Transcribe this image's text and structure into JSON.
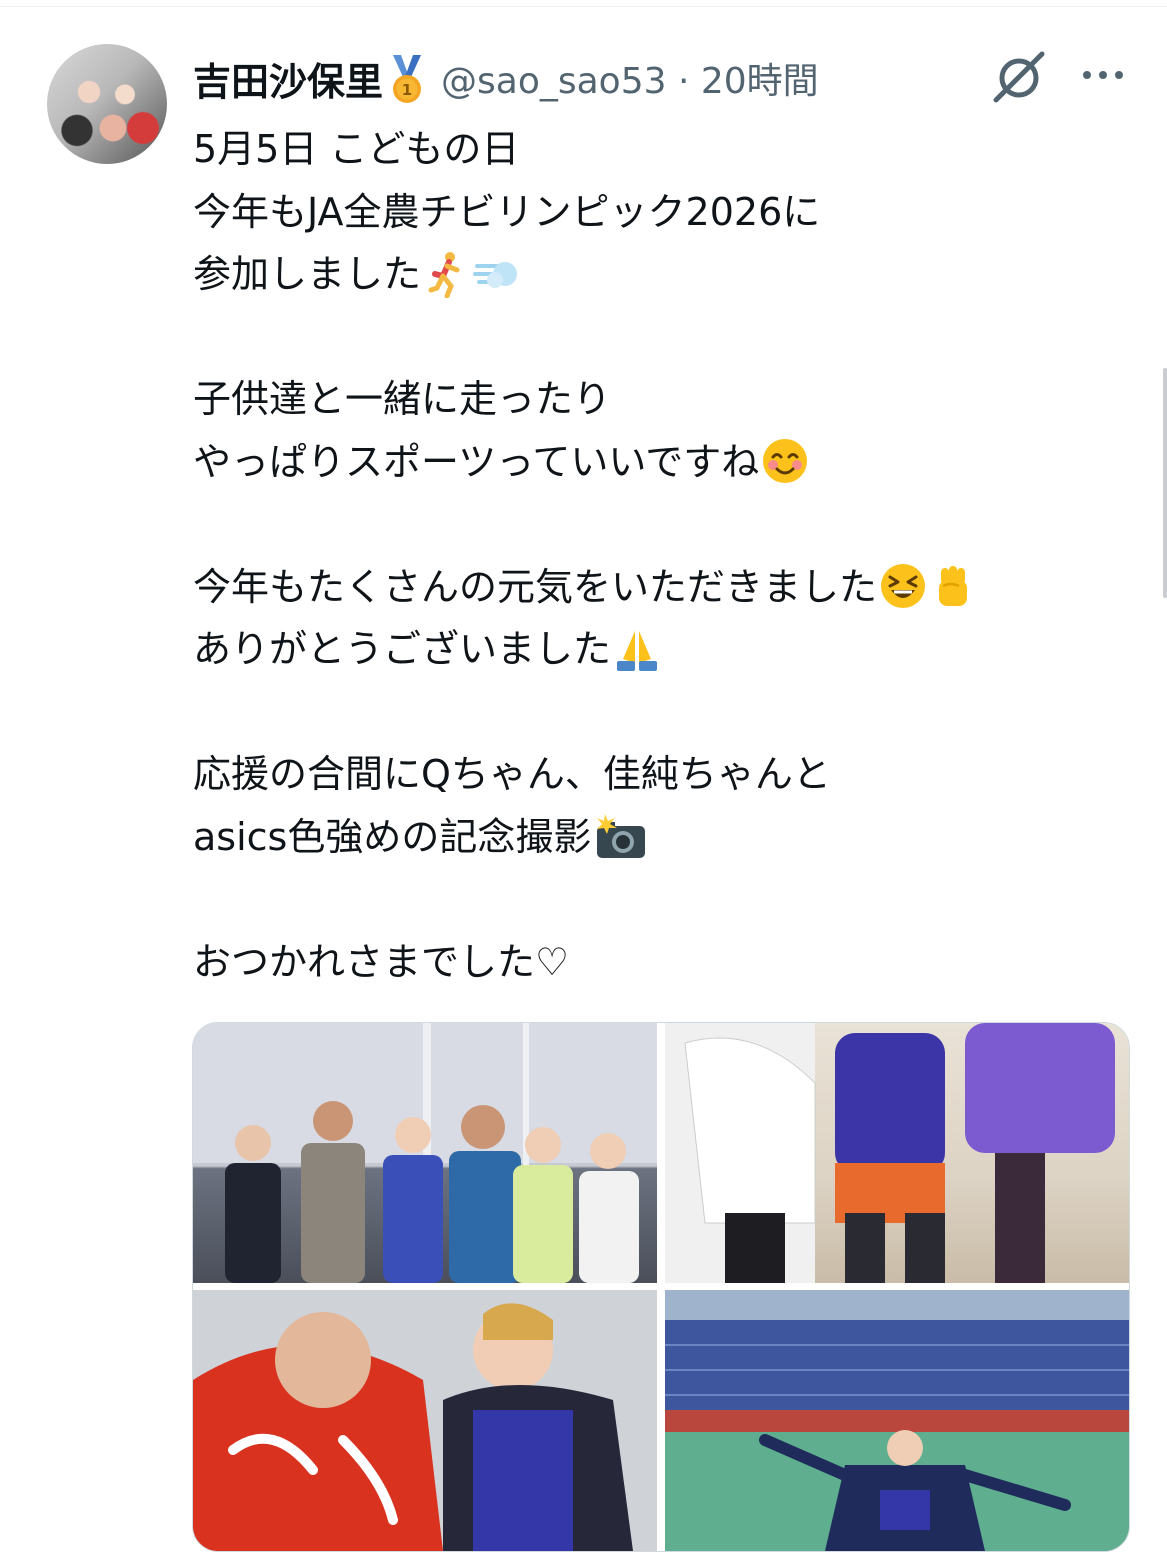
{
  "tweet": {
    "author_name": "吉田沙保里",
    "author_badge": "medal-icon",
    "handle_time": "@sao_sao53 · 20時間",
    "lines": [
      "5月5日 こどもの日",
      "今年もJA全農チビリンピック2026に",
      "参加しました",
      "",
      "子供達と一緒に走ったり",
      "やっぱりスポーツっていいですね",
      "",
      "今年もたくさんの元気をいただきました",
      "ありがとうございました",
      "",
      "応援の合間にQちゃん、佳純ちゃんと",
      "asics色強めの記念撮影",
      "",
      "おつかれさまでした♡"
    ],
    "emoji_names": {
      "line3": [
        "runner-emoji",
        "dash-emoji"
      ],
      "line6": [
        "smiling-face-emoji"
      ],
      "line8": [
        "laughing-face-emoji",
        "fist-emoji"
      ],
      "line9": [
        "pray-emoji"
      ],
      "line12": [
        "camera-flash-emoji"
      ]
    },
    "photos": [
      {
        "name": "group-photo",
        "caption_visible": ""
      },
      {
        "name": "posing-photo",
        "caption_visible": ""
      },
      {
        "name": "selfie-photo",
        "caption_visible": ""
      },
      {
        "name": "stadium-photo",
        "caption_visible": ""
      }
    ]
  },
  "icons": {
    "grok": "grok-icon",
    "more": "more-icon"
  },
  "colors": {
    "text": "#0f1419",
    "secondary": "#536471",
    "border": "#cfd9de"
  }
}
